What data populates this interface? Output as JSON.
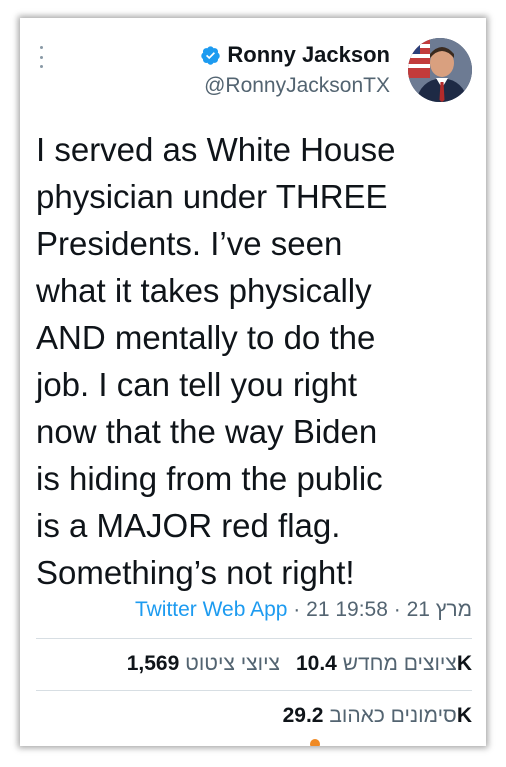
{
  "author": {
    "display_name": "Ronny Jackson",
    "handle": "@RonnyJacksonTX",
    "verified_icon": "verified-badge-icon",
    "avatar_icon": "profile-photo"
  },
  "tweet": {
    "text": "I served as White House\nphysician under THREE\nPresidents. I’ve seen\nwhat it takes physically\nAND mentally to do the\njob. I can tell you right\nnow that the way Biden\nis hiding from the public\nis a MAJOR red flag.\nSomething’s not right!"
  },
  "meta": {
    "source": "Twitter Web App",
    "separator": " · ",
    "date": "21 מרץ 21",
    "time": "19:58"
  },
  "stats": {
    "retweets_count": "10.4K",
    "retweets_label": "ציוצים מחדש",
    "quotes_count": "1,569",
    "quotes_label": "ציוצי ציטוט",
    "likes_count": "29.2K",
    "likes_label": "סימונים כאהוב"
  },
  "colors": {
    "link": "#1d9bf0",
    "muted": "#536471",
    "text": "#0f1419",
    "indicator": "#f08a24"
  }
}
